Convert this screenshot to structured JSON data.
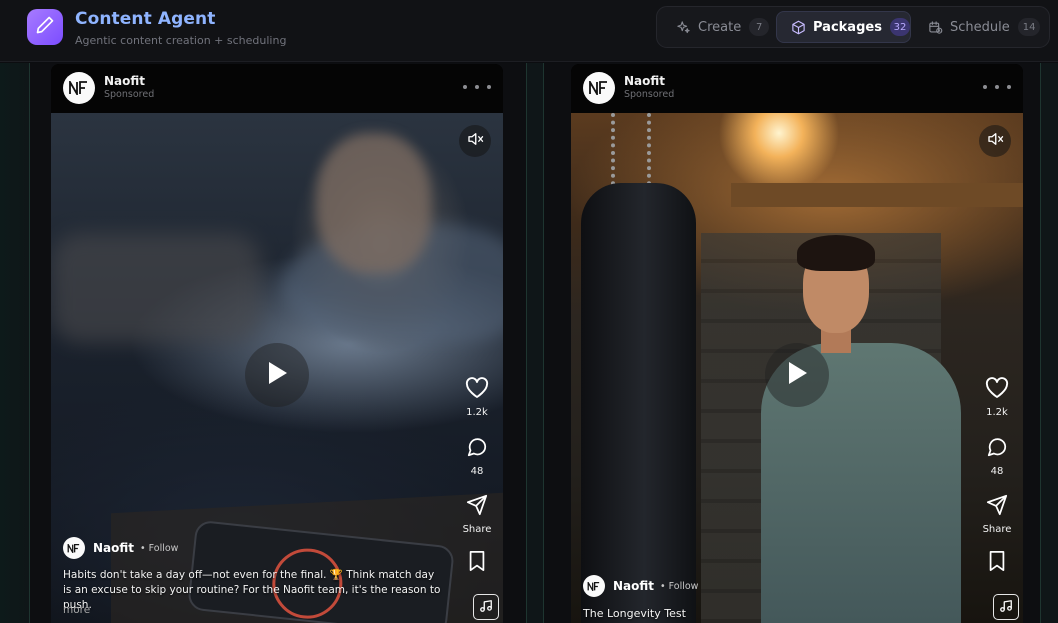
{
  "app": {
    "title": "Content Agent",
    "subtitle": "Agentic content creation + scheduling",
    "accent": "#8fb4ff",
    "logo_icon": "pencil-icon"
  },
  "tabs": [
    {
      "label": "Create",
      "count": "7",
      "icon": "sparkle-icon",
      "active": false
    },
    {
      "label": "Packages",
      "count": "32",
      "icon": "package-icon",
      "active": true
    },
    {
      "label": "Schedule",
      "count": "14",
      "icon": "calendar-clock-icon",
      "active": false
    }
  ],
  "posts": [
    {
      "brand": "Naofit",
      "sponsored": "Sponsored",
      "likes": "1.2k",
      "comments": "48",
      "share_label": "Share",
      "follow": "• Follow",
      "caption": "Habits don't take a day off—not even for the final. 🏆 Think match day is an excuse to skip your routine? For the Naofit team, it's the reason to push.",
      "more": "more"
    },
    {
      "brand": "Naofit",
      "sponsored": "Sponsored",
      "likes": "1.2k",
      "comments": "48",
      "share_label": "Share",
      "follow": "• Follow",
      "caption": "The Longevity Test"
    }
  ]
}
